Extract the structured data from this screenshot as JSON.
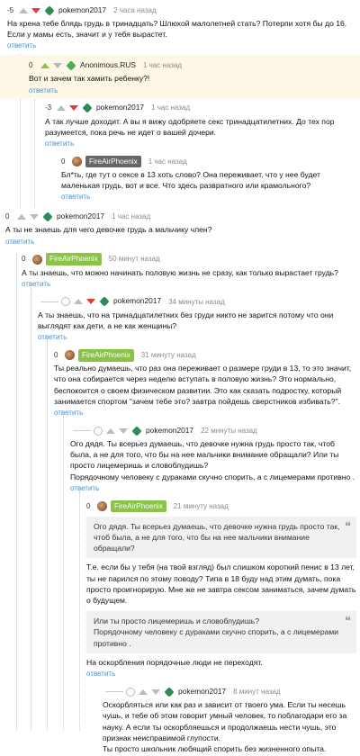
{
  "colors": {
    "accent": "#8ac34a",
    "reply": "#4a8fd1",
    "down": "#e53935",
    "badge_bg": "#8ac34a",
    "badge_grey": "#666666",
    "highlight": "#fff7e6"
  },
  "reply_label": "ответить",
  "comments": [
    {
      "rating": "-5",
      "author": "pokemon2017",
      "time": "2 часа назад",
      "text": "На хрена тебе блядь грудь в тринадцать? Шлюхой малолетней стать? Потерпи хотя бы до 16. Если у мамы есть, значит и у тебя вырастет."
    },
    {
      "rating": "0",
      "author": "Anonimous.RUS",
      "time": "1 час назад",
      "text": "Вот и зачем так хамить ребенку?!"
    },
    {
      "rating": "-3",
      "author": "pokemon2017",
      "time": "1 час назад",
      "text": "А так лучше доходит. А вы я вижу одобряете секс тринадцатилетних. До тех пор разумеется, пока речь не идет о вашей дочери."
    },
    {
      "rating": "0",
      "author": "FireAirPhoenix",
      "time": "1 час назад",
      "text": "Бл*ть, где тут о сексе в 13 хоть слово? Она переживает, что у нее будет маленькая грудь, вот и все. Что здесь развратного или крамольного?"
    },
    {
      "rating": "0",
      "author": "pokemon2017",
      "time": "1 час назад",
      "text": "А ты не знаешь для чего девочке грудь а мальчику член?"
    },
    {
      "rating": "0",
      "author": "FireAirPhoenix",
      "time": "50 минут назад",
      "text": "А ты знаешь, что можно начинать половую жизнь не сразу, как только вырастает грудь?"
    },
    {
      "rating": "",
      "author": "pokemon2017",
      "time": "34 минуты назад",
      "text": "А ты знаешь, что на тринадцатилетних без груди никто не зарится потому что они выглядят как дети, а не как женщины?"
    },
    {
      "rating": "0",
      "author": "FireAirPhoenix",
      "time": "31 минуту назад",
      "text": "Ты реально думаешь, что раз она переживает о размере груди в 13, то это значит, что она собирается через неделю вступать в половую жизнь? Это нормально, беспокоится о своем физическом развитии. Это как сказать подростку, который занимается спортом \"зачем тебе это? завтра пойдешь сверстников избивать?\"."
    },
    {
      "rating": "",
      "author": "pokemon2017",
      "time": "22 минуты назад",
      "text": "Ого дядя. Ты всерьез думаешь, что девочке нужна грудь просто так, чтоб была, а не для того, что бы на нее мальчики внимание обращали? Или ты просто лицемеришь и словоблудишь?",
      "text2": "Порядочному человеку с дураками скучно спорить, а с лицемерами противно ."
    },
    {
      "rating": "0",
      "author": "FireAirPhoenix",
      "time": "21 минуту назад",
      "quote1": "Ого дядя. Ты всерьез думаешь, что девочке нужна грудь просто так, чтоб была, а не для того, что бы на нее мальчики внимание обращали?",
      "text": "Т.е. если бы у тебя (на твой взгляд) был слишком короткий пенис в 13 лет, ты не парился по этому поводу? Типа в 18 буду над этим думать, пока просто проигнорирую. Мне же не завтра сексом заниматься, зачем думать о будущем.",
      "quote2a": "Или ты просто лицемеришь и словоблудишь?",
      "quote2b": "Порядочному человеку с дураками скучно спорить, а с лицемерами противно .",
      "text2": "На оскорбления порядочные люди не переходят."
    },
    {
      "rating": "",
      "author": "pokemon2017",
      "time": "8 минут назад",
      "text": "Оскорбляться или как раз и зависит от твоего ума. Если ты несешь чушь, и тебе об этом говорит умный человек, то поблагодари его за науку. А если ты оскорбляешься и продолжаешь нести чушь, это признак неисправимой глупости.",
      "text2": "Ты просто школьник любящий спорить без жизненного опыта."
    }
  ]
}
